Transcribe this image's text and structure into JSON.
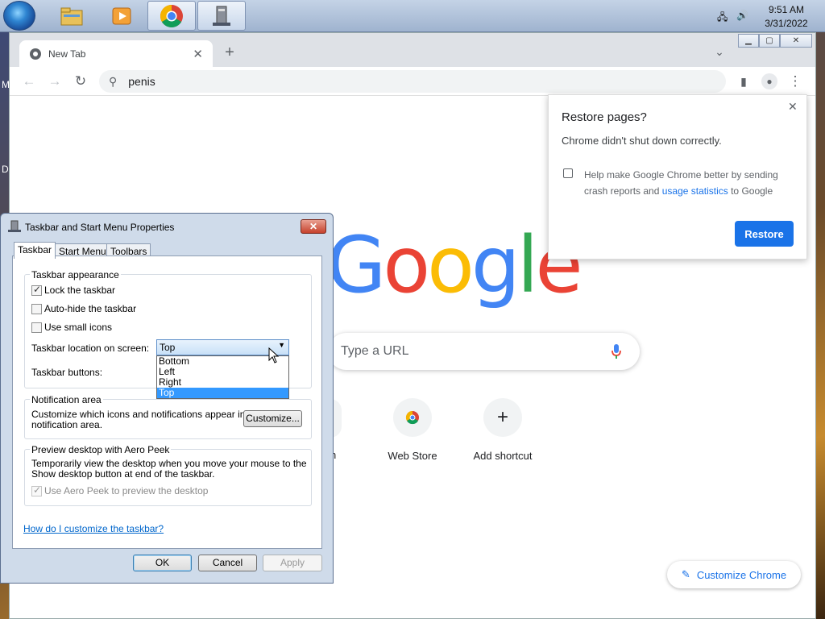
{
  "taskbar": {
    "time": "9:51 AM",
    "date": "3/31/2022",
    "apps": [
      "explorer-icon",
      "media-player-icon",
      "chrome-icon",
      "taskbar-properties-icon"
    ]
  },
  "chrome": {
    "tab_title": "New Tab",
    "omnibox_value": "penis",
    "search_placeholder": "Type a URL",
    "logo": [
      "G",
      "o",
      "o",
      "g",
      "l",
      "e"
    ],
    "shortcuts": [
      {
        "label": "Web Store"
      },
      {
        "label": "Add shortcut",
        "glyph": "+"
      }
    ],
    "cut_label": "n",
    "customize_label": "Customize Chrome",
    "restore": {
      "title": "Restore pages?",
      "message": "Chrome didn't shut down correctly.",
      "checkbox_text_1": "Help make Google Chrome better by sending",
      "checkbox_text_2": "crash reports and ",
      "link": "usage statistics",
      "checkbox_text_3": " to Google",
      "button": "Restore"
    }
  },
  "dialog": {
    "title": "Taskbar and Start Menu Properties",
    "tabs": [
      "Taskbar",
      "Start Menu",
      "Toolbars"
    ],
    "appearance_group": "Taskbar appearance",
    "lock": "Lock the taskbar",
    "autohide": "Auto-hide the taskbar",
    "small_icons": "Use small icons",
    "location_label": "Taskbar location on screen:",
    "location_value": "Top",
    "location_options": [
      "Bottom",
      "Left",
      "Right",
      "Top"
    ],
    "buttons_label": "Taskbar buttons:",
    "notification_group": "Notification area",
    "notification_text_1": "Customize which icons and notifications appear in the",
    "notification_text_2": "notification area.",
    "customize_button": "Customize...",
    "peek_group": "Preview desktop with Aero Peek",
    "peek_text_1": "Temporarily view the desktop when you move your mouse to the",
    "peek_text_2": "Show desktop button at end of the taskbar.",
    "peek_check": "Use Aero Peek to preview the desktop",
    "help_link": "How do I customize the taskbar?",
    "ok": "OK",
    "cancel": "Cancel",
    "apply": "Apply"
  },
  "desktop_letters": [
    "M",
    "D"
  ]
}
